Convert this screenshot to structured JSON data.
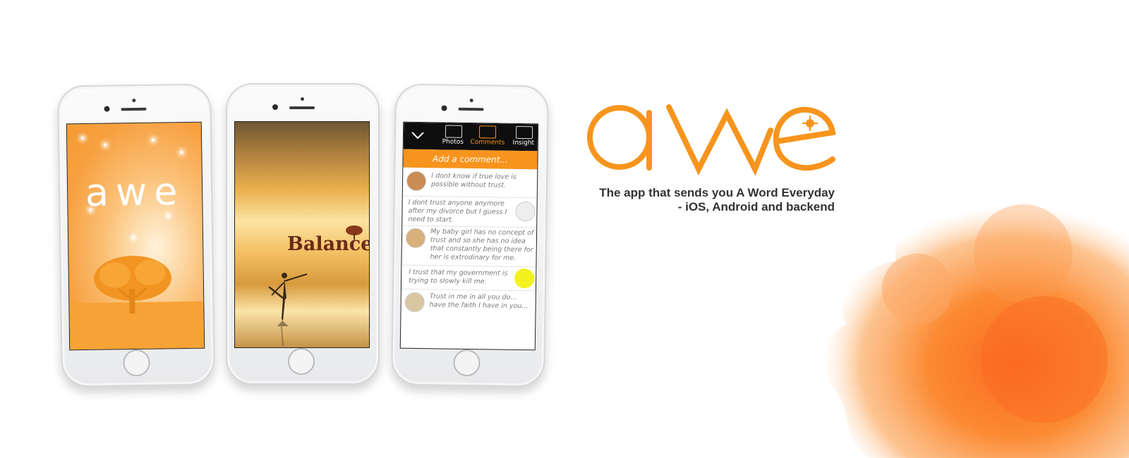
{
  "brand": {
    "logo_text": "awe",
    "accent_color": "#F7941D",
    "tagline_line1": "The app that sends you A Word Everyday",
    "tagline_line2": "- iOS, Android and backend"
  },
  "phone1": {
    "logo_text": "awe",
    "illustration": "tree-icon"
  },
  "phone2": {
    "word": "Balance",
    "illustration": "dancer-silhouette"
  },
  "phone3": {
    "nav": {
      "back_icon": "chevron-down-icon",
      "photos_label": "Photos",
      "comments_label": "Comments",
      "insight_label": "Insight"
    },
    "add_comment_placeholder": "Add a comment...",
    "comments": [
      {
        "text": "I dont know if true love is possible without trust.",
        "avatar": "avatar-icon"
      },
      {
        "text": "I dont trust anyone anymore after my divorce but I guess I need to start.",
        "avatar": "avatar-icon"
      },
      {
        "text": "My baby girl has no concept of trust and so she has no idea that constantly being there for her is extrodinary for me.",
        "avatar": "avatar-icon"
      },
      {
        "text": "I trust that my government is trying to slowly kill me.",
        "avatar": "avatar-icon"
      },
      {
        "text": "Trust in me in all you do... have the faith I have in you...",
        "avatar": "avatar-icon"
      }
    ]
  }
}
